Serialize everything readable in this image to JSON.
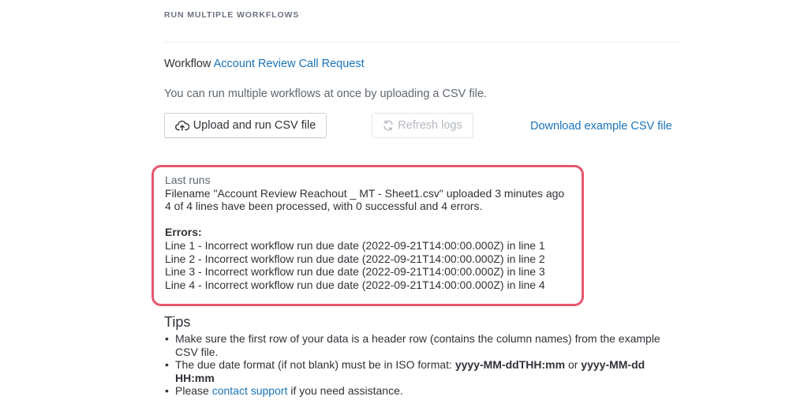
{
  "header": {
    "section_title": "RUN MULTIPLE WORKFLOWS"
  },
  "workflow": {
    "label": "Workflow",
    "name": "Account Review Call Request"
  },
  "description": "You can run multiple workflows at once by uploading a CSV file.",
  "actions": {
    "upload_label": "Upload and run CSV file",
    "refresh_label": "Refresh logs",
    "refresh_disabled": true,
    "download_label": "Download example CSV file"
  },
  "last_runs": {
    "heading": "Last runs",
    "filename_line": "Filename \"Account Review Reachout _ MT - Sheet1.csv\" uploaded 3 minutes ago",
    "summary_line": "4 of 4 lines have been processed, with 0 successful and 4 errors.",
    "errors_heading": "Errors:",
    "errors": [
      "Line 1 - Incorrect workflow run due date (2022-09-21T14:00:00.000Z) in line 1",
      "Line 2 - Incorrect workflow run due date (2022-09-21T14:00:00.000Z) in line 2",
      "Line 3 - Incorrect workflow run due date (2022-09-21T14:00:00.000Z) in line 3",
      "Line 4 - Incorrect workflow run due date (2022-09-21T14:00:00.000Z) in line 4"
    ]
  },
  "tips": {
    "heading": "Tips",
    "tip1": "Make sure the first row of your data is a header row (contains the column names) from the example CSV file.",
    "tip2_prefix": "The due date format (if not blank) must be in ISO format: ",
    "tip2_format1": "yyyy-MM-ddTHH:mm",
    "tip2_or": " or ",
    "tip2_format2": "yyyy-MM-dd HH:mm",
    "tip3_prefix": "Please ",
    "tip3_link": "contact support",
    "tip3_suffix": " if you need assistance."
  },
  "colors": {
    "accent_link": "#1a73b8",
    "highlight_border": "#e5566f",
    "text": "#2f3237",
    "muted_text": "#5f6770"
  },
  "icons": {
    "upload": "cloud-upload-icon",
    "refresh": "refresh-icon"
  }
}
